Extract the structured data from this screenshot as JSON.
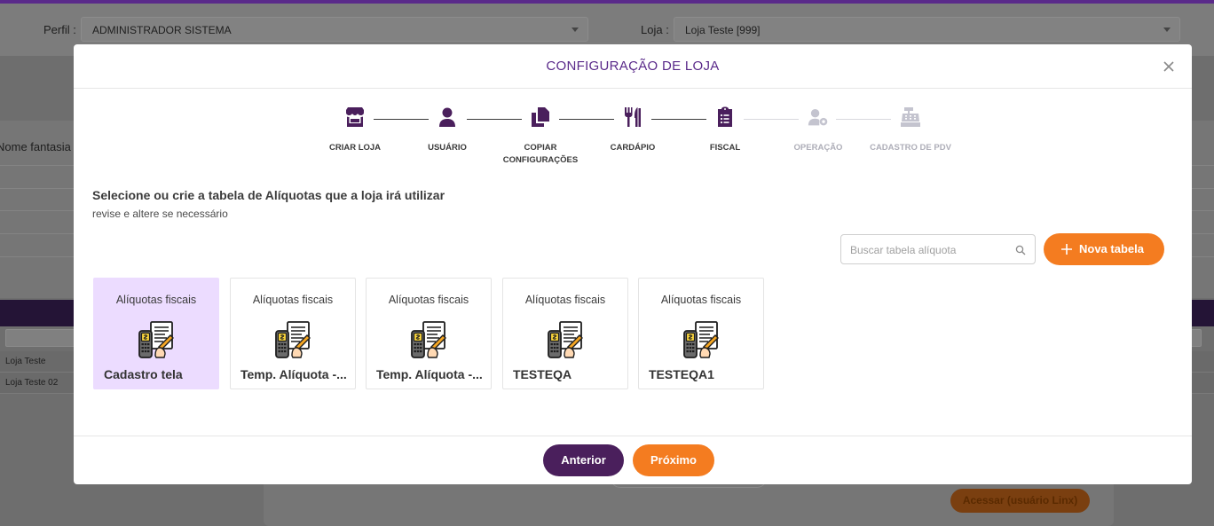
{
  "background": {
    "perfil_label": "Perfil :",
    "perfil_value": "ADMINISTRADOR SISTEMA",
    "loja_label": "Loja :",
    "loja_value": "Loja Teste [999]",
    "nome_fantasia_label": "Nome fantasia :",
    "rows": [
      "Loja Teste",
      "Loja Teste 02"
    ],
    "access_button": "Acessar (usuário Linx)"
  },
  "modal": {
    "title": "CONFIGURAÇÃO DE LOJA",
    "steps": [
      {
        "label": "CRIAR LOJA",
        "icon": "store-icon",
        "active": true
      },
      {
        "label": "USUÁRIO",
        "icon": "user-icon",
        "active": true
      },
      {
        "label": "COPIAR CONFIGURAÇÕES",
        "icon": "copy-icon",
        "active": true
      },
      {
        "label": "CARDÁPIO",
        "icon": "utensils-icon",
        "active": true
      },
      {
        "label": "FISCAL",
        "icon": "clipboard-list-icon",
        "active": true
      },
      {
        "label": "OPERAÇÃO",
        "icon": "user-cog-icon",
        "active": false
      },
      {
        "label": "CADASTRO DE PDV",
        "icon": "cash-register-icon",
        "active": false
      }
    ],
    "heading": "Selecione ou crie a tabela de Alíquotas que a loja irá utilizar",
    "subheading": "revise e altere se necessário",
    "search_placeholder": "Buscar tabela alíquota",
    "new_table_label": "Nova tabela",
    "tiles": [
      {
        "category": "Alíquotas fiscais",
        "name": "Cadastro tela",
        "selected": true
      },
      {
        "category": "Alíquotas fiscais",
        "name": "Temp. Alíquota -...",
        "selected": false
      },
      {
        "category": "Alíquotas fiscais",
        "name": "Temp. Alíquota -...",
        "selected": false
      },
      {
        "category": "Alíquotas fiscais",
        "name": "TESTEQA",
        "selected": false
      },
      {
        "category": "Alíquotas fiscais",
        "name": "TESTEQA1",
        "selected": false
      }
    ],
    "prev_label": "Anterior",
    "next_label": "Próximo"
  },
  "colors": {
    "accent_purple": "#5a2a8a",
    "dark_purple": "#4a1f5c",
    "orange": "#f47c20",
    "selected_tile": "#ecdcff"
  }
}
